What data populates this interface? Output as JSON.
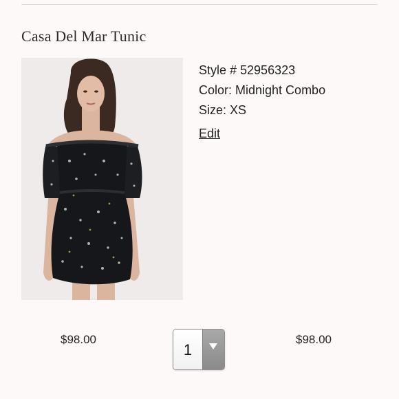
{
  "product": {
    "title": "Casa Del Mar Tunic",
    "style": "Style # 52956323",
    "color": "Color: Midnight Combo",
    "size": "Size: XS",
    "edit_label": "Edit"
  },
  "pricing": {
    "unit_price": "$98.00",
    "total_price": "$98.00"
  },
  "quantity": {
    "selected": "1",
    "arrow_icon": "chevron-down-icon"
  },
  "colors": {
    "background": "#fdf9f8",
    "text": "#222222",
    "image_background": "#eeebea"
  }
}
